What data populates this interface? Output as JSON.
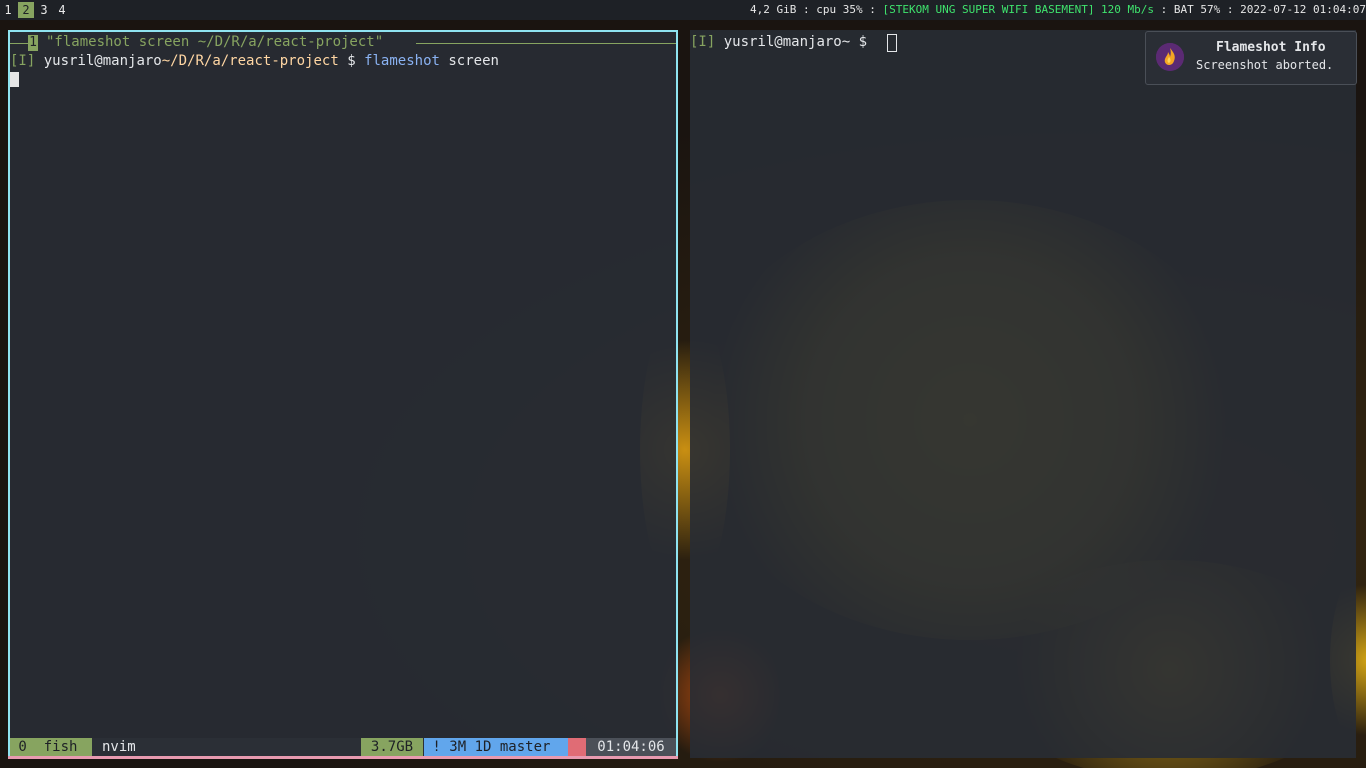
{
  "workspaces": [
    {
      "label": "1",
      "active": false
    },
    {
      "label": "2",
      "active": true
    },
    {
      "label": "3",
      "active": false
    },
    {
      "label": "4",
      "active": false
    }
  ],
  "status": {
    "mem": "4,2 GiB",
    "cpu": "cpu 35%",
    "net": "[STEKOM UNG SUPER WIFI BASEMENT] 120 Mb/s",
    "bat": "BAT 57%",
    "datetime": "2022-07-12 01:04:07",
    "sep": " : "
  },
  "left_terminal": {
    "window_number": "1",
    "window_title": "\"flameshot screen  ~/D/R/a/react-project\"",
    "mode": "[I]",
    "user_host": "yusril@manjaro",
    "cwd": "~/D/R/a/react-project",
    "dollar": "$",
    "command": "flameshot",
    "argument": "screen"
  },
  "tmux_bar": {
    "window": " 0  fish",
    "nvim": "nvim",
    "mem": "3.7GB",
    "git": " ! 3M 1D master",
    "time": "01:04:06"
  },
  "right_terminal": {
    "mode": "[I]",
    "user_host": "yusril@manjaro",
    "cwd": "~",
    "dollar": "$"
  },
  "notification": {
    "title": "Flameshot Info",
    "body": "Screenshot aborted.",
    "icon": "flameshot-icon"
  },
  "colors": {
    "accent_green": "#87a460",
    "border_cyan": "#8fe3f0",
    "border_pink": "#e89ab0",
    "net_green": "#3fe36d",
    "git_blue": "#61a6ec"
  }
}
